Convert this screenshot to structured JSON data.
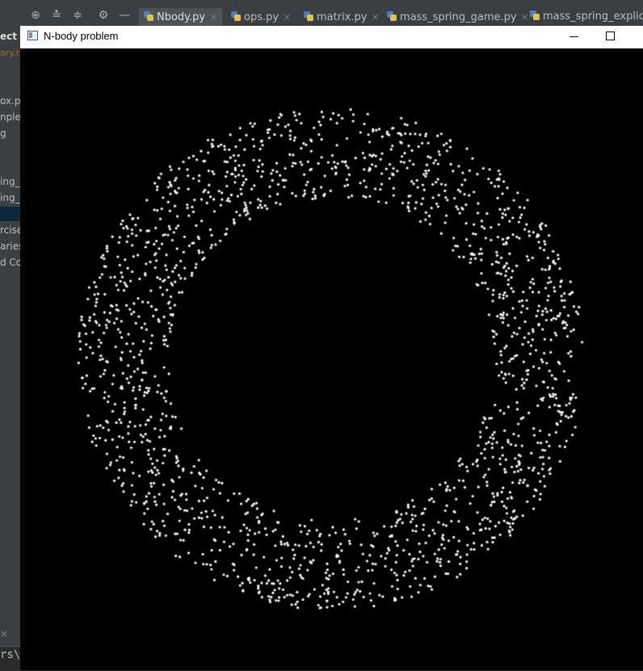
{
  "ide": {
    "tabs": [
      {
        "label": "Nbody.py",
        "active": true
      },
      {
        "label": "ops.py",
        "active": false
      },
      {
        "label": "matrix.py",
        "active": false
      },
      {
        "label": "mass_spring_game.py",
        "active": false
      },
      {
        "label": "mass_spring_explicit.p",
        "active": false
      }
    ],
    "toolbar_icons": [
      "target-icon",
      "expand-all-icon",
      "collapse-all-icon",
      "gear-icon",
      "minimize-icon"
    ],
    "close_glyph": "×"
  },
  "project_panel": {
    "title": "ect",
    "path_fragment": "ary.r",
    "rows": [
      {
        "label": "ox.py",
        "selected": false
      },
      {
        "label": "nple",
        "selected": false
      },
      {
        "label": "g",
        "selected": false
      },
      {
        "label": "ing_e",
        "selected": false
      },
      {
        "label": "ing_g",
        "selected": false
      },
      {
        "label": "",
        "selected": true
      },
      {
        "label": "rcise",
        "selected": false
      },
      {
        "label": "aries",
        "selected": false
      },
      {
        "label": "d Co",
        "selected": false
      }
    ],
    "terminal_prompt": "rs\\",
    "terminal_close": "×"
  },
  "window": {
    "title": "N-body problem",
    "canvas": {
      "background": "#000000",
      "particle_color": "#ffffff",
      "particle_count": 1800,
      "ring_inner_radius_fraction": 0.27,
      "ring_outer_radius_fraction": 0.42
    }
  }
}
